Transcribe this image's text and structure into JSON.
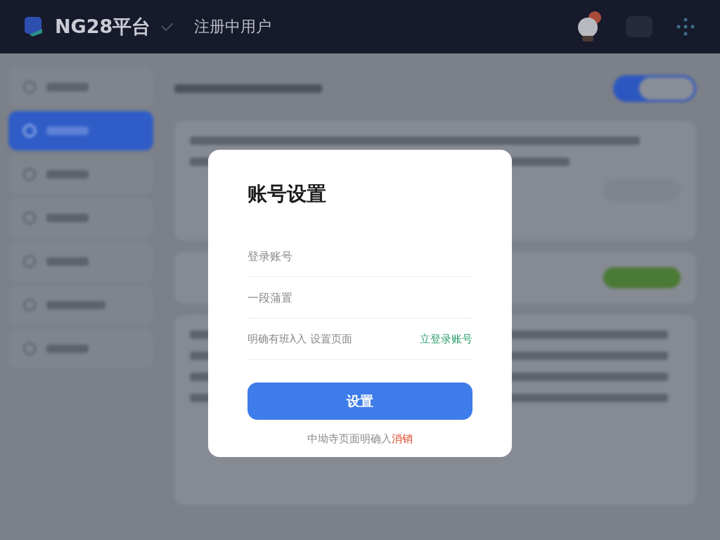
{
  "header": {
    "brand": "NG28平台",
    "section": "注册中用户"
  },
  "toggle": {
    "on": true
  },
  "sidebar": {
    "items": [
      {
        "selected": false
      },
      {
        "selected": true
      },
      {
        "selected": false
      },
      {
        "selected": false
      },
      {
        "selected": false
      },
      {
        "selected": false
      },
      {
        "selected": false
      }
    ]
  },
  "dialog": {
    "title": "账号设置",
    "fields": [
      {
        "placeholder": "登录账号"
      },
      {
        "placeholder": "一段蒲置"
      }
    ],
    "hint": {
      "text": "明确有班λ入 设置页面",
      "link": "立登录账号"
    },
    "submit": "设置",
    "footer": {
      "text": "中坳寺页面明确入",
      "link": "消销"
    }
  }
}
